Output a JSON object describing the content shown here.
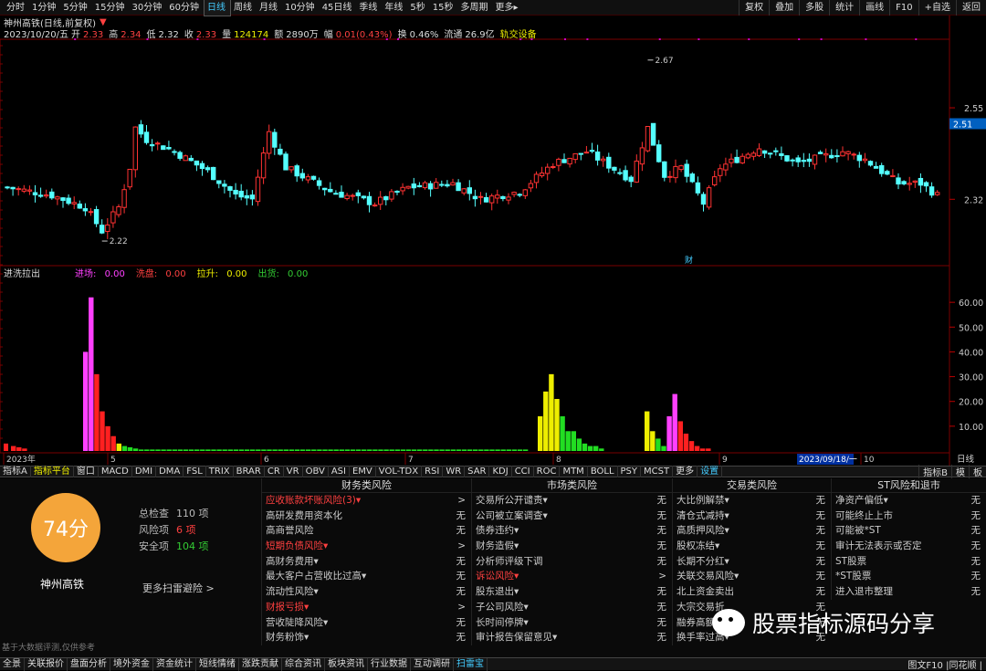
{
  "periods": [
    "分时",
    "1分钟",
    "5分钟",
    "15分钟",
    "30分钟",
    "60分钟",
    "日线",
    "周线",
    "月线",
    "10分钟",
    "45日线",
    "季线",
    "年线",
    "5秒",
    "15秒",
    "多周期",
    "更多▸"
  ],
  "active_period": "日线",
  "right_buttons": [
    "复权",
    "叠加",
    "多股",
    "统计",
    "画线",
    "F10",
    "+自选",
    "返回"
  ],
  "title_line": "神州高铁(日线,前复权)",
  "info": {
    "date": "2023/10/20/五",
    "open_label": "开",
    "open": "2.33",
    "high_label": "高",
    "high": "2.34",
    "low_label": "低",
    "low": "2.32",
    "close_label": "收",
    "close": "2.33",
    "vol_label": "量",
    "vol": "124174",
    "amt_label": "额",
    "amt": "2890万",
    "chg_label": "幅",
    "chg": "0.01(0.43%)",
    "turn_label": "换",
    "turn": "0.46%",
    "float_label": "流通",
    "float": "26.9亿",
    "sector": "轨交设备"
  },
  "price_axis": {
    "ticks": [
      "2.55",
      "2.51",
      "2.32"
    ],
    "current": "2.51",
    "ymin": 2.16,
    "ymax": 2.72
  },
  "annotations": {
    "high": "2.67",
    "low": "2.22",
    "fin": "财"
  },
  "indicator": {
    "name": "进洗拉出",
    "items": [
      {
        "label": "进场:",
        "value": "0.00",
        "color": "#ff40ff"
      },
      {
        "label": "洗盘:",
        "value": "0.00",
        "color": "#ff4040"
      },
      {
        "label": "拉升:",
        "value": "0.00",
        "color": "#eeee00"
      },
      {
        "label": "出货:",
        "value": "0.00",
        "color": "#33cc33"
      }
    ],
    "y_ticks": [
      "60.00",
      "50.00",
      "40.00",
      "30.00",
      "20.00",
      "10.00"
    ]
  },
  "x_axis": {
    "labels": [
      "2023年",
      "5",
      "6",
      "7",
      "8",
      "9",
      "10"
    ],
    "cursor_date": "2023/09/18/一",
    "right": "日线"
  },
  "tabs": [
    "指标A",
    "指标平台",
    "窗口",
    "MACD",
    "DMI",
    "DMA",
    "FSL",
    "TRIX",
    "BRAR",
    "CR",
    "VR",
    "OBV",
    "ASI",
    "EMV",
    "VOL-TDX",
    "RSI",
    "WR",
    "SAR",
    "KDJ",
    "CCI",
    "ROC",
    "MTM",
    "BOLL",
    "PSY",
    "MCST",
    "更多",
    "设置"
  ],
  "tabs_right": [
    "指标B",
    "模",
    "板"
  ],
  "risk": {
    "score": "74分",
    "stock_name": "神州高铁",
    "total_label": "总检查",
    "total": "110 项",
    "risk_label": "风险项",
    "risk_count": "6 项",
    "safe_label": "安全项",
    "safe_count": "104 项",
    "more_scan": "更多扫雷避险 >",
    "disclaimer": "基于大数据评测,仅供参考"
  },
  "risk_columns": [
    {
      "title": "财务类风险",
      "rows": [
        {
          "name": "应收账款坏账风险(3)▾",
          "value": ">",
          "hl": true
        },
        {
          "name": "高研发费用资本化",
          "value": "无",
          "hl": false
        },
        {
          "name": "高商誉风险",
          "value": "无",
          "hl": false
        },
        {
          "name": "短期负债风险▾",
          "value": ">",
          "hl": true
        },
        {
          "name": "高财务费用▾",
          "value": "无",
          "hl": false
        },
        {
          "name": "最大客户占营收比过高▾",
          "value": "无",
          "hl": false
        },
        {
          "name": "流动性风险▾",
          "value": "无",
          "hl": false
        },
        {
          "name": "财报亏损▾",
          "value": ">",
          "hl": true
        },
        {
          "name": "营收陡降风险▾",
          "value": "无",
          "hl": false
        },
        {
          "name": "财务粉饰▾",
          "value": "无",
          "hl": false
        }
      ]
    },
    {
      "title": "市场类风险",
      "rows": [
        {
          "name": "交易所公开谴责▾",
          "value": "无",
          "hl": false
        },
        {
          "name": "公司被立案调查▾",
          "value": "无",
          "hl": false
        },
        {
          "name": "债券违约▾",
          "value": "无",
          "hl": false
        },
        {
          "name": "财务造假▾",
          "value": "无",
          "hl": false
        },
        {
          "name": "分析师评级下调",
          "value": "无",
          "hl": false
        },
        {
          "name": "诉讼风险▾",
          "value": ">",
          "hl": true
        },
        {
          "name": "股东退出▾",
          "value": "无",
          "hl": false
        },
        {
          "name": "子公司风险▾",
          "value": "无",
          "hl": false
        },
        {
          "name": "长时间停牌▾",
          "value": "无",
          "hl": false
        },
        {
          "name": "审计报告保留意见▾",
          "value": "无",
          "hl": false
        }
      ]
    },
    {
      "title": "交易类风险",
      "rows": [
        {
          "name": "大比例解禁▾",
          "value": "无",
          "hl": false
        },
        {
          "name": "清仓式减持▾",
          "value": "无",
          "hl": false
        },
        {
          "name": "高质押风险▾",
          "value": "无",
          "hl": false
        },
        {
          "name": "股权冻结▾",
          "value": "无",
          "hl": false
        },
        {
          "name": "长期不分红▾",
          "value": "无",
          "hl": false
        },
        {
          "name": "关联交易风险▾",
          "value": "无",
          "hl": false
        },
        {
          "name": "北上资金卖出",
          "value": "无",
          "hl": false
        },
        {
          "name": "大宗交易折",
          "value": "无",
          "hl": false
        },
        {
          "name": "融券高额",
          "value": "无",
          "hl": false
        },
        {
          "name": "换手率过高▾",
          "value": "无",
          "hl": false
        }
      ]
    },
    {
      "title": "ST风险和退市",
      "rows": [
        {
          "name": "净资产偏低▾",
          "value": "无",
          "hl": false
        },
        {
          "name": "可能终止上市",
          "value": "无",
          "hl": false
        },
        {
          "name": "可能被*ST",
          "value": "无",
          "hl": false
        },
        {
          "name": "审计无法表示或否定",
          "value": "无",
          "hl": false
        },
        {
          "name": "ST股票",
          "value": "无",
          "hl": false
        },
        {
          "name": "*ST股票",
          "value": "无",
          "hl": false
        },
        {
          "name": "进入退市整理",
          "value": "无",
          "hl": false
        }
      ]
    }
  ],
  "bottom_nav": [
    "全景",
    "关联报价",
    "盘面分析",
    "境外资金",
    "资金统计",
    "短线情绪",
    "涨跌贡献",
    "综合资讯",
    "板块资讯",
    "行业数据",
    "互动调研",
    "扫雷宝"
  ],
  "bottom_active": "扫雷宝",
  "bottom_right": "图文F10 |同花顺 |",
  "watermark": "股票指标源码分享",
  "colors": {
    "up": "#ff3232",
    "down": "#54ffff",
    "entry": "#ff40ff",
    "wash": "#ff2020",
    "pull": "#eeee00",
    "exit": "#22dd22",
    "score": "#f4a53a"
  }
}
